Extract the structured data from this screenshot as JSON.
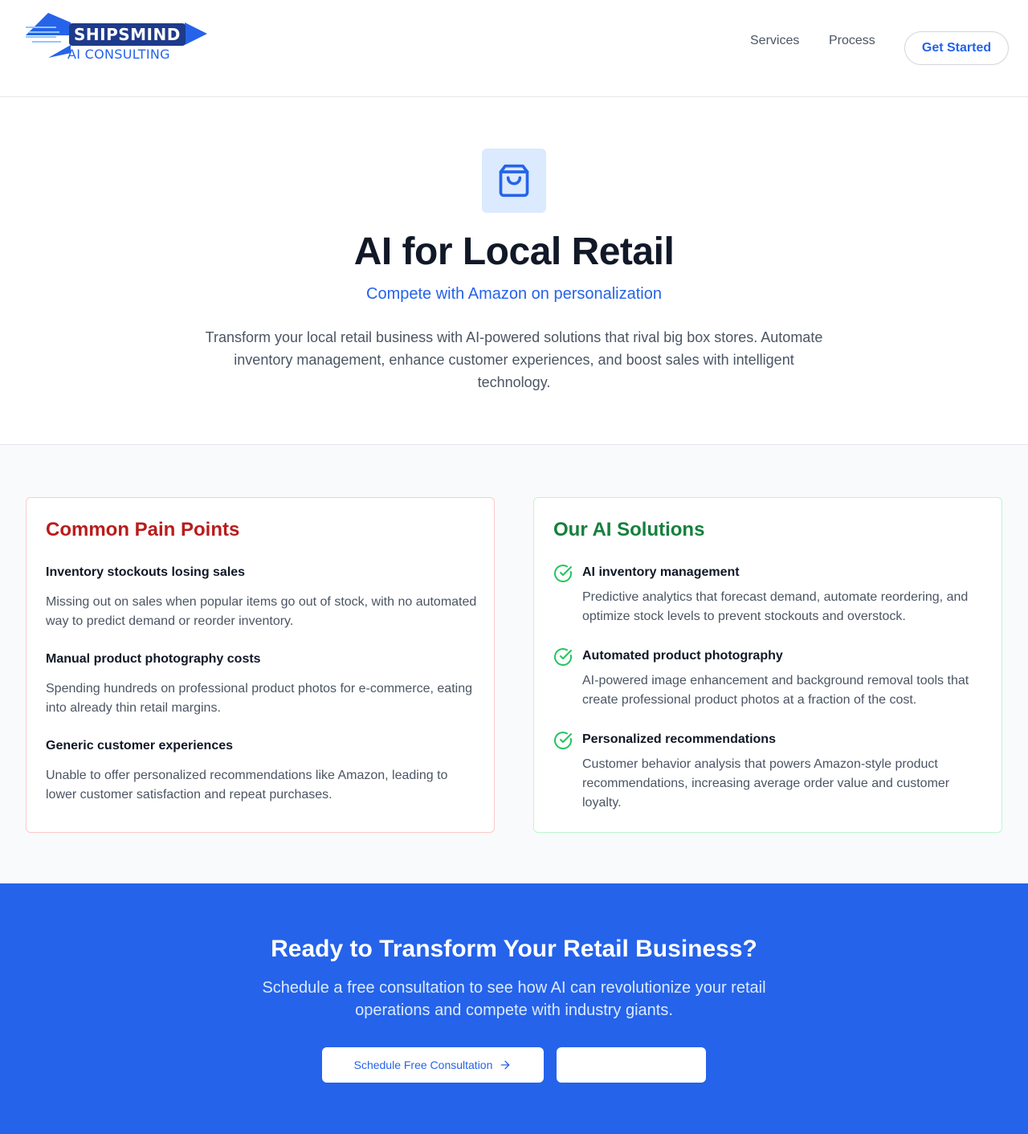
{
  "header": {
    "logo": {
      "brand": "SHIPSMIND",
      "tagline": "AI CONSULTING"
    },
    "nav": [
      {
        "label": "Services"
      },
      {
        "label": "Process"
      }
    ],
    "cta_label": "Get Started"
  },
  "hero": {
    "icon": "shopping-bag-icon",
    "title": "AI for Local Retail",
    "subtitle": "Compete with Amazon on personalization",
    "description": "Transform your local retail business with AI-powered solutions that rival big box stores. Automate inventory management, enhance customer experiences, and boost sales with intelligent technology."
  },
  "pain_points": {
    "title": "Common Pain Points",
    "items": [
      {
        "title": "Inventory stockouts losing sales",
        "description": "Missing out on sales when popular items go out of stock, with no automated way to predict demand or reorder inventory."
      },
      {
        "title": "Manual product photography costs",
        "description": "Spending hundreds on professional product photos for e-commerce, eating into already thin retail margins."
      },
      {
        "title": "Generic customer experiences",
        "description": "Unable to offer personalized recommendations like Amazon, leading to lower customer satisfaction and repeat purchases."
      }
    ]
  },
  "solutions": {
    "title": "Our AI Solutions",
    "icon": "check-circle-icon",
    "items": [
      {
        "title": "AI inventory management",
        "description": "Predictive analytics that forecast demand, automate reordering, and optimize stock levels to prevent stockouts and overstock."
      },
      {
        "title": "Automated product photography",
        "description": "AI-powered image enhancement and background removal tools that create professional product photos at a fraction of the cost."
      },
      {
        "title": "Personalized recommendations",
        "description": "Customer behavior analysis that powers Amazon-style product recommendations, increasing average order value and customer loyalty."
      }
    ]
  },
  "cta": {
    "title": "Ready to Transform Your Retail Business?",
    "description": "Schedule a free consultation to see how AI can revolutionize your retail operations and compete with industry giants.",
    "primary_label": "Schedule Free Consultation",
    "secondary_label": ""
  },
  "colors": {
    "accent": "#2563eb",
    "pain": "#b91c1c",
    "solution": "#15803d",
    "check": "#22c55e"
  }
}
